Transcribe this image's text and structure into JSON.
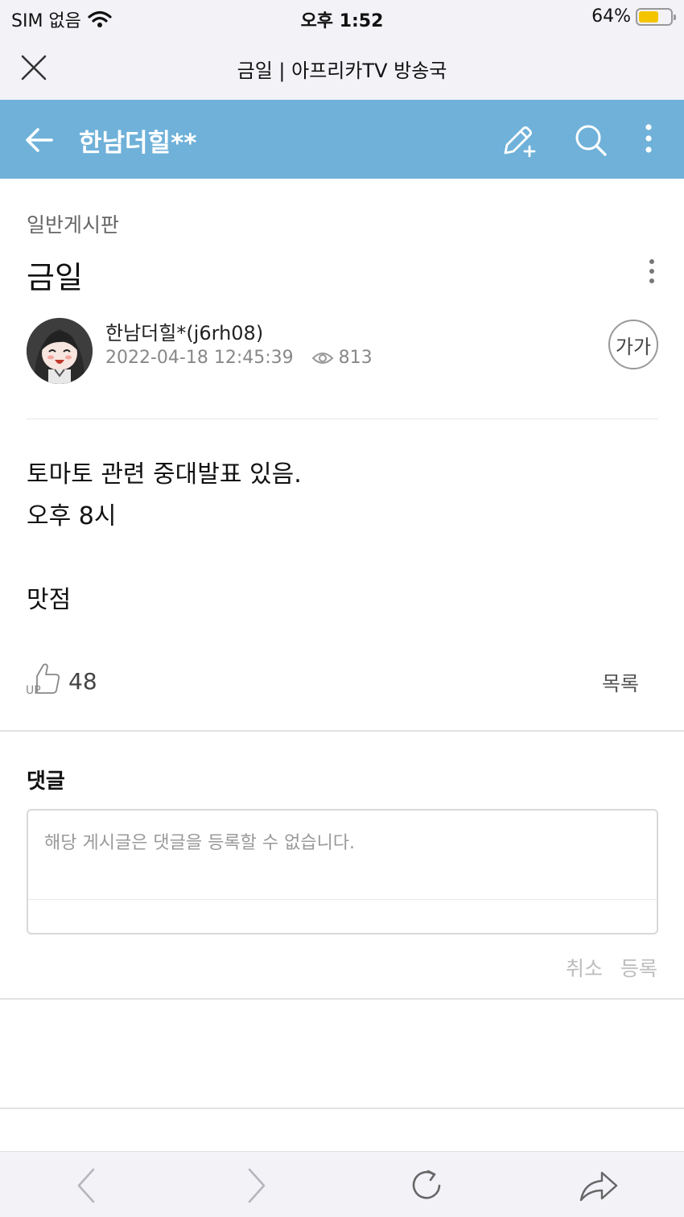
{
  "status_bar": {
    "carrier": "SIM 없음",
    "time": "오후 1:52",
    "battery": "64%",
    "battery_level": 0.64
  },
  "browser": {
    "page_title": "금일 | 아프리카TV 방송국"
  },
  "app_header": {
    "station_name": "한남더힐**"
  },
  "post": {
    "board": "일반게시판",
    "title": "금일",
    "author": "한남더힐*(j6rh08)",
    "date": "2022-04-18 12:45:39",
    "views": "813",
    "font_size_label": "가가",
    "body": [
      "토마토 관련 중대발표 있음.",
      "오후 8시",
      "맛점"
    ],
    "up_count": "48",
    "list_label": "목록"
  },
  "comments": {
    "label": "댓글",
    "placeholder": "해당 게시글은 댓글을 등록할 수 없습니다.",
    "cancel_label": "취소",
    "submit_label": "등록"
  },
  "colors": {
    "header_bg": "#6fb1d9",
    "battery_fill": "#f5c400"
  }
}
